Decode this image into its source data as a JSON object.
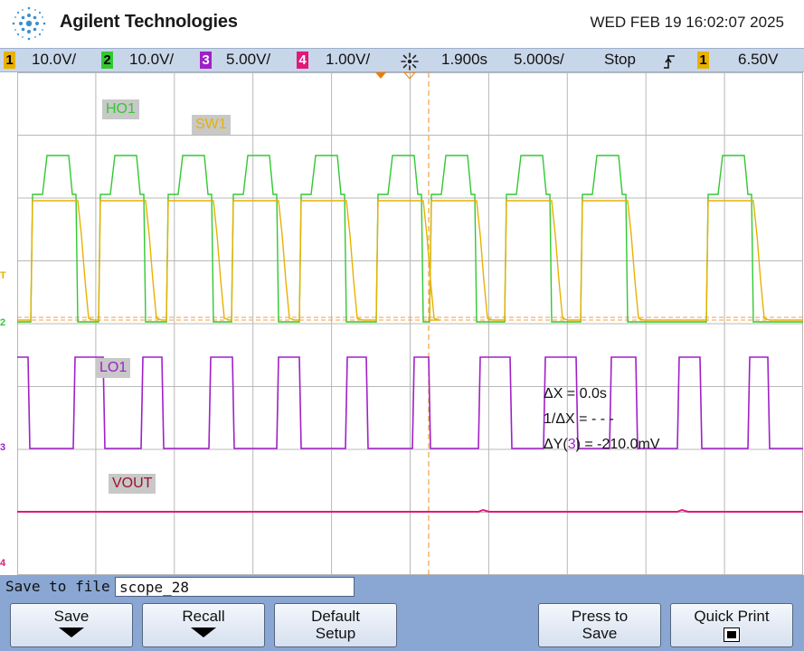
{
  "header": {
    "brand": "Agilent Technologies",
    "datetime": "WED FEB 19 16:02:07 2025"
  },
  "status": {
    "ch1_num": "1",
    "ch1_scale": "10.0V/",
    "ch2_num": "2",
    "ch2_scale": "10.0V/",
    "ch3_num": "3",
    "ch3_scale": "5.00V/",
    "ch4_num": "4",
    "ch4_scale": "1.00V/",
    "time_delay": "1.900s",
    "time_scale": "5.000s/",
    "run_state": "Stop",
    "trigger_icon": "trigger-edge-icon",
    "trigger_source": "1",
    "trigger_level": "6.50V"
  },
  "traces": {
    "ho1": "HO1",
    "sw1": "SW1",
    "lo1": "LO1",
    "vout": "VOUT"
  },
  "ground_marks": {
    "t": "T",
    "g2": "2",
    "g3": "3",
    "g4": "4"
  },
  "measurements": {
    "dx": "ΔX = 0.0s",
    "inv_dx": "1/ΔX = - - -",
    "dy_prefix": "ΔY(",
    "dy_channel": "3",
    "dy_suffix": ") = -210.0mV"
  },
  "save": {
    "label": "Save to file =",
    "filename": "scope_28"
  },
  "softkeys": {
    "save": "Save",
    "recall": "Recall",
    "default_line1": "Default",
    "default_line2": "Setup",
    "press_line1": "Press to",
    "press_line2": "Save",
    "quick_print": "Quick Print"
  },
  "colors": {
    "ch1": "#e8b100",
    "ch2": "#32c832",
    "ch3": "#a020c8",
    "ch4": "#e0197a",
    "cursor": "#f0a040"
  }
}
